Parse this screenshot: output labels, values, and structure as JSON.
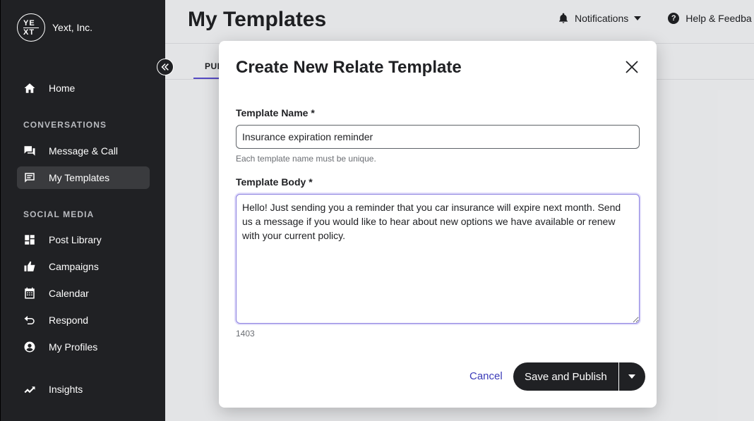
{
  "sidebar": {
    "brand": {
      "logo_top": "YE",
      "logo_bottom": "XT",
      "name": "Yext, Inc."
    },
    "items": [
      {
        "label": "Home",
        "icon": "home-icon"
      },
      {
        "label": "Message & Call",
        "icon": "chat-icon"
      },
      {
        "label": "My Templates",
        "icon": "template-icon",
        "active": true
      },
      {
        "label": "Post Library",
        "icon": "grid-icon"
      },
      {
        "label": "Campaigns",
        "icon": "thumbs-up-icon"
      },
      {
        "label": "Calendar",
        "icon": "calendar-icon"
      },
      {
        "label": "Respond",
        "icon": "reply-icon"
      },
      {
        "label": "My Profiles",
        "icon": "profile-icon"
      },
      {
        "label": "Insights",
        "icon": "trend-icon"
      }
    ],
    "sections": {
      "conversations": "CONVERSATIONS",
      "social": "SOCIAL MEDIA"
    }
  },
  "header": {
    "title": "My Templates",
    "notifications": "Notifications",
    "help": "Help & Feedba",
    "tab_published": "PUB"
  },
  "modal": {
    "title": "Create New Relate Template",
    "name_label": "Template Name *",
    "name_value": "Insurance expiration reminder",
    "name_hint": "Each template name must be unique.",
    "body_label": "Template Body *",
    "body_value": "Hello! Just sending you a reminder that you car insurance will expire next month. Send us a message if you would like to hear about new options we have available or renew with your current policy.",
    "char_count": "1403",
    "cancel": "Cancel",
    "save": "Save and Publish"
  },
  "colors": {
    "sidebar_bg": "#202124",
    "accent": "#5a4fcf",
    "link": "#3b3bb8"
  }
}
